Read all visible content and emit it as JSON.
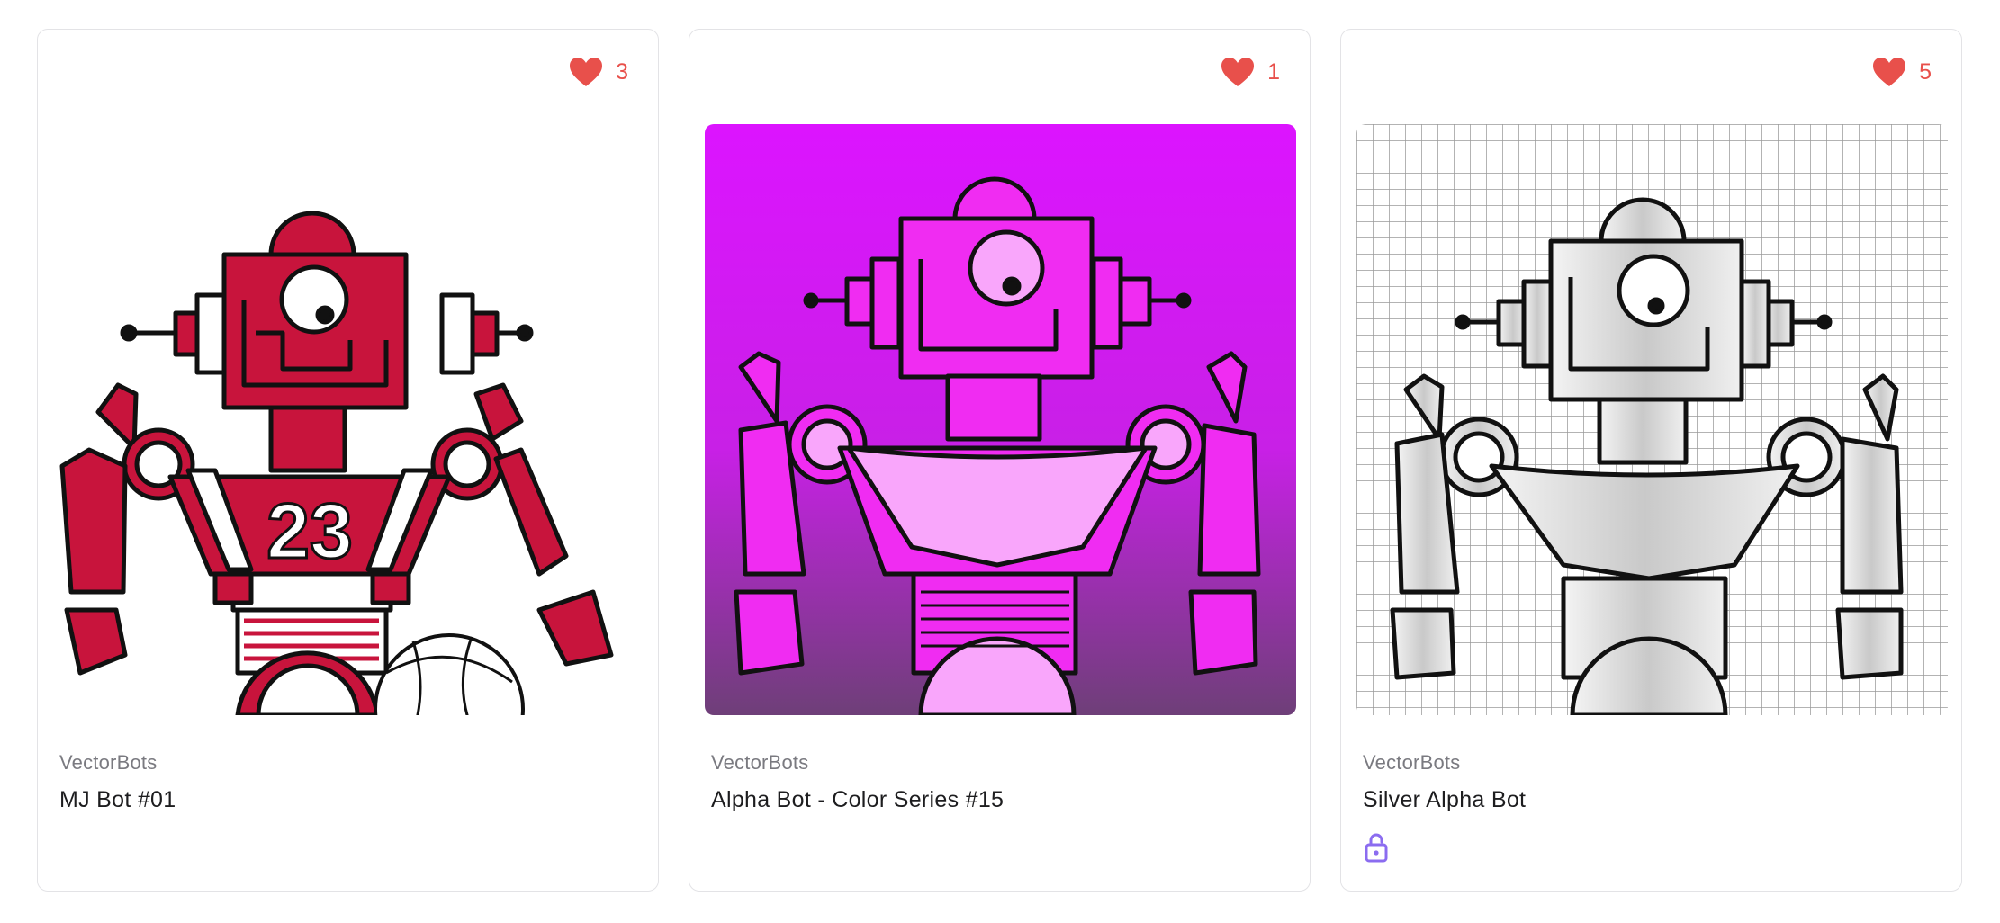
{
  "cards": [
    {
      "likes": "3",
      "creator": "VectorBots",
      "title": "MJ Bot #01",
      "jersey_number": "23",
      "art_theme": "red-white",
      "colors": {
        "primary": "#c8143c",
        "background": "#ffffff"
      },
      "icons": {
        "like": "heart-icon"
      }
    },
    {
      "likes": "1",
      "creator": "VectorBots",
      "title": "Alpha Bot - Color Series #15",
      "art_theme": "magenta",
      "colors": {
        "primary": "#f02cf2",
        "background_top": "#dc14ff",
        "background_bottom": "#6e3f78"
      },
      "icons": {
        "like": "heart-icon"
      }
    },
    {
      "likes": "5",
      "creator": "VectorBots",
      "title": "Silver Alpha Bot",
      "art_theme": "silver-grid",
      "colors": {
        "primary": "#d0d0d0",
        "background": "#ffffff"
      },
      "icons": {
        "like": "heart-icon",
        "status": "unlock-icon"
      }
    }
  ],
  "accent": {
    "like": "#e8504b",
    "lock": "#8b6cf0"
  }
}
